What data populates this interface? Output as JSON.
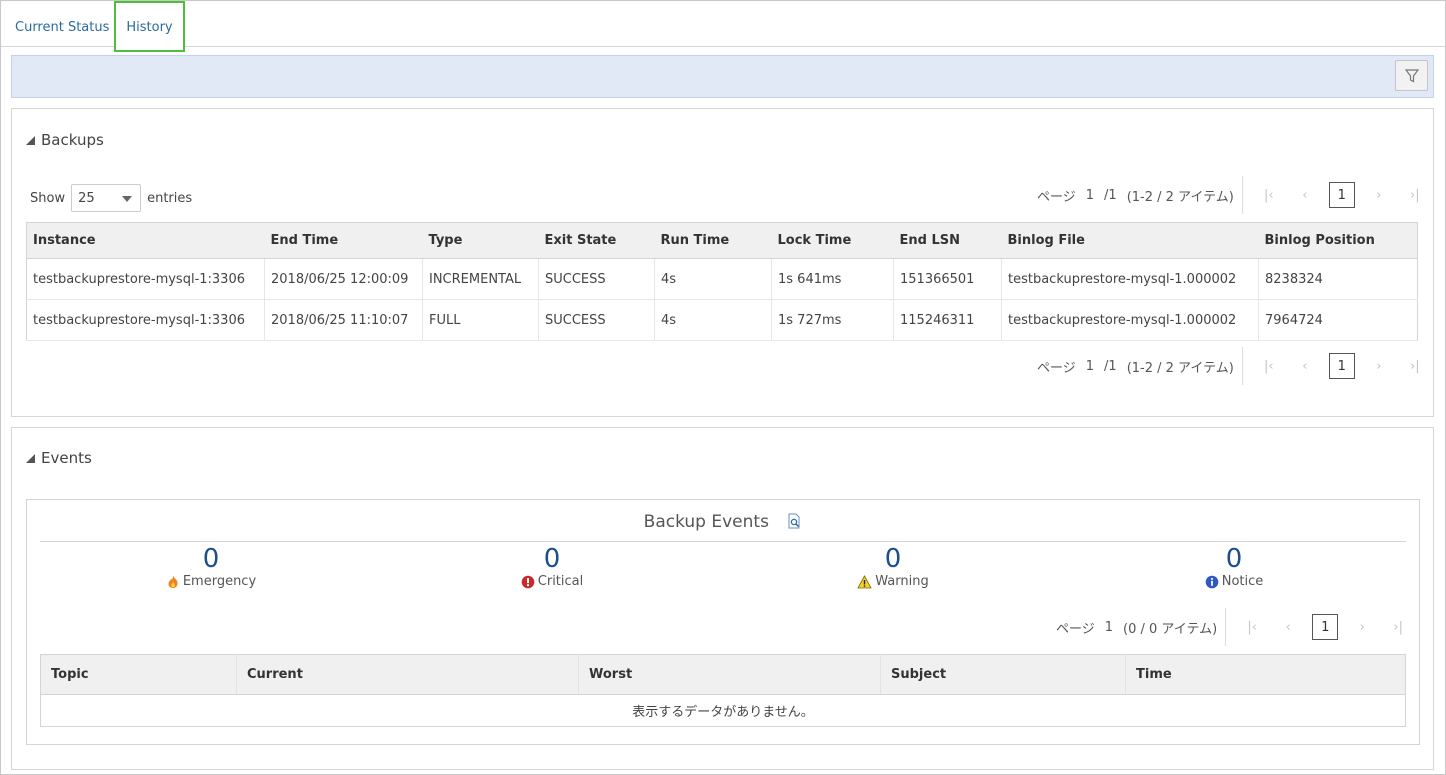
{
  "tabs": [
    {
      "label": "Current Status",
      "active": false
    },
    {
      "label": "History",
      "active": true
    }
  ],
  "backups": {
    "title": "Backups",
    "show_label": "Show",
    "entries_label": "entries",
    "page_size": "25",
    "pager": {
      "page_label": "ページ",
      "page": "1",
      "total_pages": "/1",
      "items": "(1-2 / 2 アイテム)",
      "current": "1"
    },
    "columns": [
      "Instance",
      "End Time",
      "Type",
      "Exit State",
      "Run Time",
      "Lock Time",
      "End LSN",
      "Binlog File",
      "Binlog Position"
    ],
    "rows": [
      [
        "testbackuprestore-mysql-1:3306",
        "2018/06/25 12:00:09",
        "INCREMENTAL",
        "SUCCESS",
        "4s",
        "1s 641ms",
        "151366501",
        "testbackuprestore-mysql-1.000002",
        "8238324"
      ],
      [
        "testbackuprestore-mysql-1:3306",
        "2018/06/25 11:10:07",
        "FULL",
        "SUCCESS",
        "4s",
        "1s 727ms",
        "115246311",
        "testbackuprestore-mysql-1.000002",
        "7964724"
      ]
    ]
  },
  "events": {
    "title": "Events",
    "box_title": "Backup Events",
    "counts": [
      {
        "value": "0",
        "label": "Emergency",
        "icon": "fire-icon"
      },
      {
        "value": "0",
        "label": "Critical",
        "icon": "critical-icon"
      },
      {
        "value": "0",
        "label": "Warning",
        "icon": "warning-icon"
      },
      {
        "value": "0",
        "label": "Notice",
        "icon": "info-icon"
      }
    ],
    "pager": {
      "page_label": "ページ",
      "page": "1",
      "items": "(0 / 0 アイテム)",
      "current": "1"
    },
    "columns": [
      "Topic",
      "Current",
      "Worst",
      "Subject",
      "Time"
    ],
    "empty_message": "表示するデータがありません。"
  },
  "colors": {
    "accent_link": "#2d6a9f",
    "active_tab_border": "#4dbf3a",
    "success": "#1f8a2a",
    "count": "#1e4f8a"
  }
}
